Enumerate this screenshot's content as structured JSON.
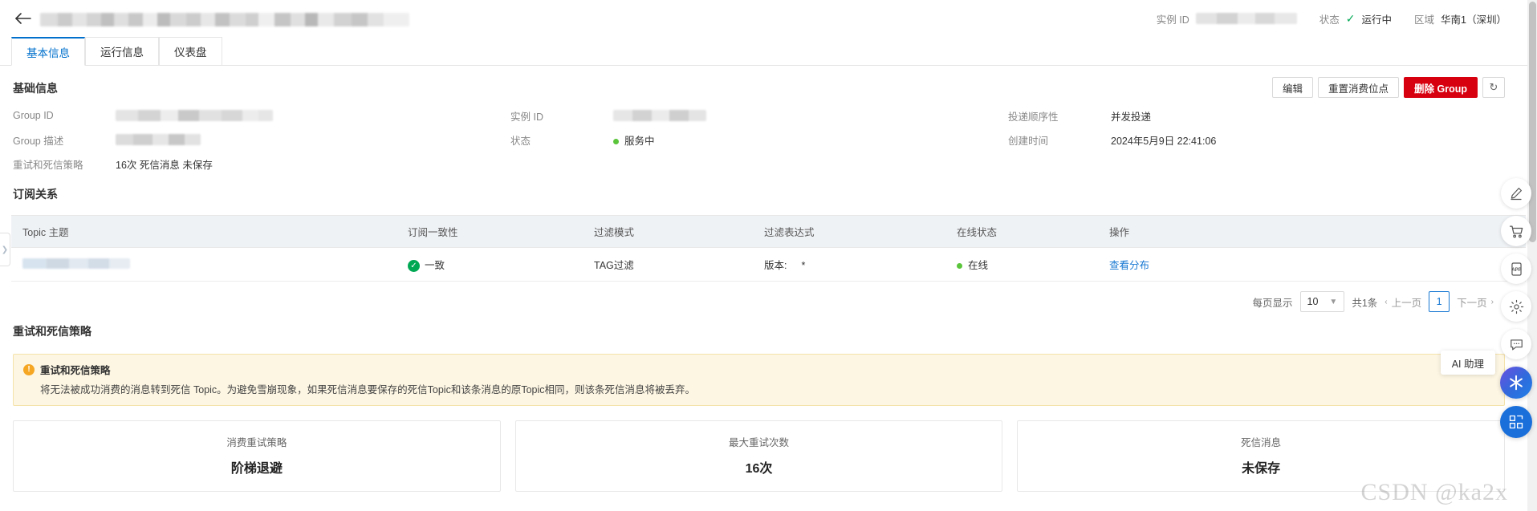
{
  "header": {
    "back_icon": "back-arrow-icon",
    "title_redacted": "",
    "meta": {
      "instance_id_label": "实例 ID",
      "instance_id_value": "",
      "status_label": "状态",
      "status_value": "运行中",
      "status_check_icon": "✓",
      "region_label": "区域",
      "region_value": "华南1（深圳）"
    }
  },
  "tabs": [
    {
      "label": "基本信息",
      "active": true
    },
    {
      "label": "运行信息",
      "active": false
    },
    {
      "label": "仪表盘",
      "active": false
    }
  ],
  "basic_info": {
    "section_title": "基础信息",
    "actions": {
      "edit": "编辑",
      "reset_offset": "重置消费位点",
      "delete_group": "删除 Group",
      "refresh_icon": "↻"
    },
    "columns": [
      [
        {
          "label": "Group ID",
          "value": "",
          "redacted": true
        },
        {
          "label": "Group 描述",
          "value": "",
          "redacted": true
        },
        {
          "label": "重试和死信策略",
          "value": "16次 死信消息 未保存",
          "redacted": false
        }
      ],
      [
        {
          "label": "实例 ID",
          "value": "",
          "redacted": true
        },
        {
          "label": "状态",
          "value": "服务中",
          "redacted": false,
          "dot": "#5ac43a"
        }
      ],
      [
        {
          "label": "投递顺序性",
          "value": "并发投递",
          "redacted": false
        },
        {
          "label": "创建时间",
          "value": "2024年5月9日 22:41:06",
          "redacted": false
        }
      ]
    ]
  },
  "subscription": {
    "section_title": "订阅关系",
    "headers": [
      "Topic 主题",
      "订阅一致性",
      "过滤模式",
      "过滤表达式",
      "在线状态",
      "操作"
    ],
    "rows": [
      {
        "topic": "",
        "consistency": "一致",
        "filter_mode": "TAG过滤",
        "filter_expr_label": "版本:",
        "filter_expr_value": "*",
        "online": "在线",
        "action": "查看分布"
      }
    ],
    "pagination": {
      "page_size_label": "每页显示",
      "page_size_value": "10",
      "total": "共1条",
      "prev": "上一页",
      "current_page": "1",
      "next": "下一页"
    }
  },
  "retry_policy": {
    "section_title": "重试和死信策略",
    "alert": {
      "title": "重试和死信策略",
      "text": "将无法被成功消费的消息转到死信 Topic。为避免雪崩现象，如果死信消息要保存的死信Topic和该条消息的原Topic相同，则该条死信消息将被丢弃。"
    },
    "cards": [
      {
        "label": "消费重试策略",
        "value": "阶梯退避"
      },
      {
        "label": "最大重试次数",
        "value": "16次"
      },
      {
        "label": "死信消息",
        "value": "未保存"
      }
    ]
  },
  "right_rail": {
    "items": [
      {
        "icon": "pencil-icon"
      },
      {
        "icon": "shopping-cart-icon"
      },
      {
        "icon": "app-icon"
      },
      {
        "icon": "gear-icon"
      },
      {
        "icon": "chat-bubble-icon"
      }
    ],
    "ai_tooltip": "AI 助理"
  },
  "watermark": "CSDN @ka2x",
  "colors": {
    "accent": "#0070cc",
    "danger": "#d7000f",
    "success": "#00a854",
    "online_dot": "#5ac43a",
    "warn": "#f5a623",
    "link": "#1677d2"
  }
}
